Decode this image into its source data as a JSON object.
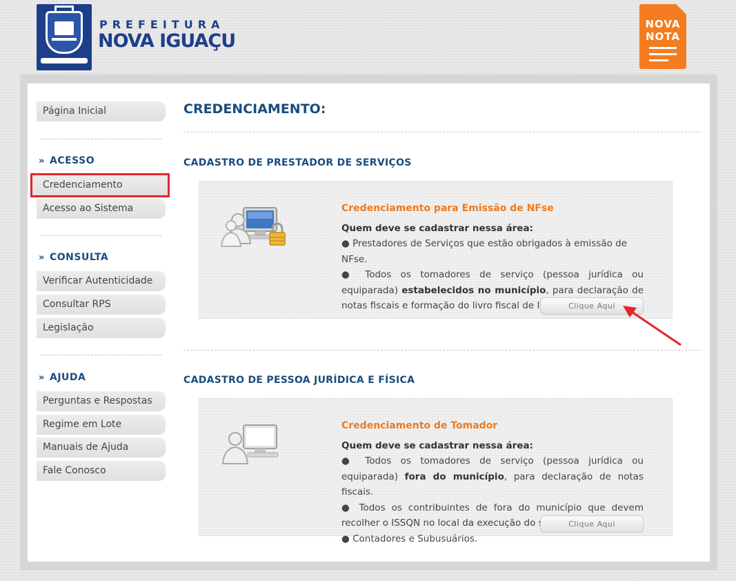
{
  "header": {
    "brand_top": "PREFEITURA",
    "brand_main": "NOVA IGUAÇU",
    "badge_line1": "NOVA",
    "badge_line2": "NOTA"
  },
  "sidebar": {
    "home": "Página Inicial",
    "sections": [
      {
        "title": "ACESSO",
        "items": [
          "Credenciamento",
          "Acesso ao Sistema"
        ]
      },
      {
        "title": "CONSULTA",
        "items": [
          "Verificar Autenticidade",
          "Consultar RPS",
          "Legislação"
        ]
      },
      {
        "title": "AJUDA",
        "items": [
          "Perguntas e Respostas",
          "Regime em Lote",
          "Manuais de Ajuda",
          "Fale Conosco"
        ]
      }
    ]
  },
  "main": {
    "page_title": "CREDENCIAMENTO:",
    "blocks": [
      {
        "heading": "CADASTRO DE PRESTADOR DE SERVIÇOS",
        "card_title": "Credenciamento para Emissão de NFse",
        "question": "Quem deve se cadastrar nessa área:",
        "p1": "● Prestadores de Serviços que estão obrigados à emissão de NFse.",
        "p2_a": "● Todos os tomadores de serviço (pessoa jurídica ou equiparada) ",
        "p2_b": "estabelecidos no município",
        "p2_c": ", para declaração de notas fiscais e formação do livro fiscal de ISSQN",
        "button": "Clique Aqui"
      },
      {
        "heading": "CADASTRO DE PESSOA JURÍDICA E FÍSICA",
        "card_title": "Credenciamento de Tomador",
        "question": "Quem deve se cadastrar nessa área:",
        "p1_a": "● Todos os tomadores de serviço (pessoa jurídica ou equiparada) ",
        "p1_b": "fora do município",
        "p1_c": ", para declaração de notas fiscais.",
        "p2": "● Todos os contribuintes de fora do município que devem recolher o ISSQN no local da execução do serviço.",
        "p3": "● Contadores e Subusuários.",
        "button": "Clique Aqui"
      }
    ]
  },
  "colors": {
    "accent_blue": "#1a4d7e",
    "accent_orange": "#ee7a1d",
    "highlight_red": "#e0262b"
  }
}
